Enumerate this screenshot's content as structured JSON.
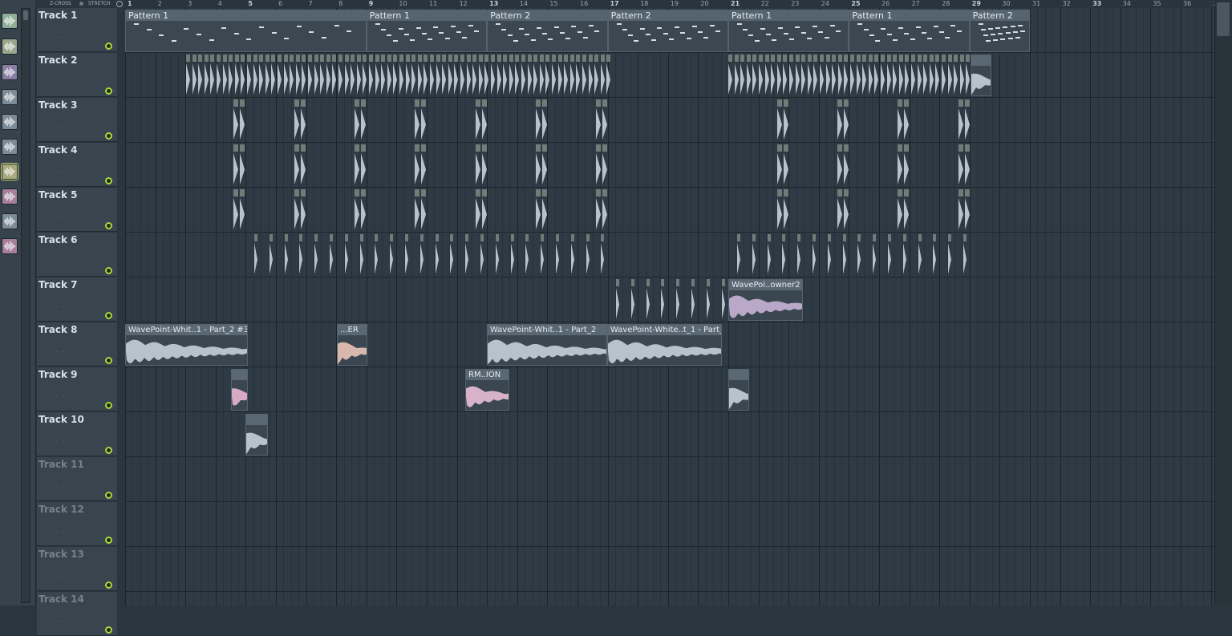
{
  "toolbar": {
    "zcross_label": "Z-CROSS",
    "stretch_label": "STRETCH"
  },
  "ruler": {
    "bars": [
      "1",
      "2",
      "3",
      "4",
      "5",
      "6",
      "7",
      "8",
      "9",
      "10",
      "11",
      "12",
      "13",
      "14",
      "15",
      "16",
      "17",
      "18",
      "19",
      "20",
      "21",
      "22",
      "23",
      "24",
      "25",
      "26",
      "27",
      "28",
      "29",
      "30",
      "31",
      "32",
      "33",
      "34",
      "35",
      "36",
      "3"
    ]
  },
  "picker": {
    "items": [
      {
        "icon": "waveform-icon",
        "color": "#8fae96"
      },
      {
        "icon": "waveform-icon",
        "color": "#9aa68a"
      },
      {
        "icon": "waveform-icon",
        "color": "#8c7fa4"
      },
      {
        "icon": "waveform-icon",
        "color": "#7d8b96"
      },
      {
        "icon": "waveform-icon",
        "color": "#7d8b96"
      },
      {
        "icon": "waveform-icon",
        "color": "#7d8b96"
      },
      {
        "icon": "waveform-icon",
        "color": "#a8a87a"
      },
      {
        "icon": "waveform-icon",
        "color": "#a77f98"
      },
      {
        "icon": "waveform-icon",
        "color": "#7d8b96"
      },
      {
        "icon": "waveform-icon",
        "color": "#a77f98"
      }
    ]
  },
  "tracks": [
    {
      "name": "Track 1"
    },
    {
      "name": "Track 2"
    },
    {
      "name": "Track 3"
    },
    {
      "name": "Track 4"
    },
    {
      "name": "Track 5"
    },
    {
      "name": "Track 6"
    },
    {
      "name": "Track 7"
    },
    {
      "name": "Track 8"
    },
    {
      "name": "Track 9"
    },
    {
      "name": "Track 10"
    },
    {
      "name": "Track 11"
    },
    {
      "name": "Track 12"
    },
    {
      "name": "Track 13"
    },
    {
      "name": "Track 14"
    }
  ],
  "clips": {
    "patterns": [
      {
        "label": "Pattern 1"
      },
      {
        "label": "Pattern 1"
      },
      {
        "label": "Pattern 2"
      },
      {
        "label": "Pattern 2"
      },
      {
        "label": "Pattern 1"
      },
      {
        "label": "Pattern 1"
      },
      {
        "label": "Pattern 2"
      }
    ],
    "audio": [
      {
        "label": "WavePoi..owner2",
        "color": "#b9a8c8"
      },
      {
        "label": "WavePoint-Whit..1 - Part_2 #3",
        "color": "#b7c3cb"
      },
      {
        "label": "...ER",
        "color": "#d8b8ad"
      },
      {
        "label": "WavePoint-Whit..1 - Part_2",
        "color": "#b7c3cb"
      },
      {
        "label": "WavePoint-White..t_1 - Part_2",
        "color": "#b7c3cb"
      },
      {
        "label": "",
        "color": "#d5aac2"
      },
      {
        "label": "RM..ION",
        "color": "#d8b2c8"
      },
      {
        "label": "",
        "color": "#b7c3cb"
      },
      {
        "label": "",
        "color": "#b7c3cb"
      },
      {
        "label": "",
        "color": "#b7c3cb"
      }
    ]
  },
  "colors": {
    "grid_bg": "#2e3b45",
    "header_bg": "#38444e",
    "mute_led": "#a9d83c"
  }
}
